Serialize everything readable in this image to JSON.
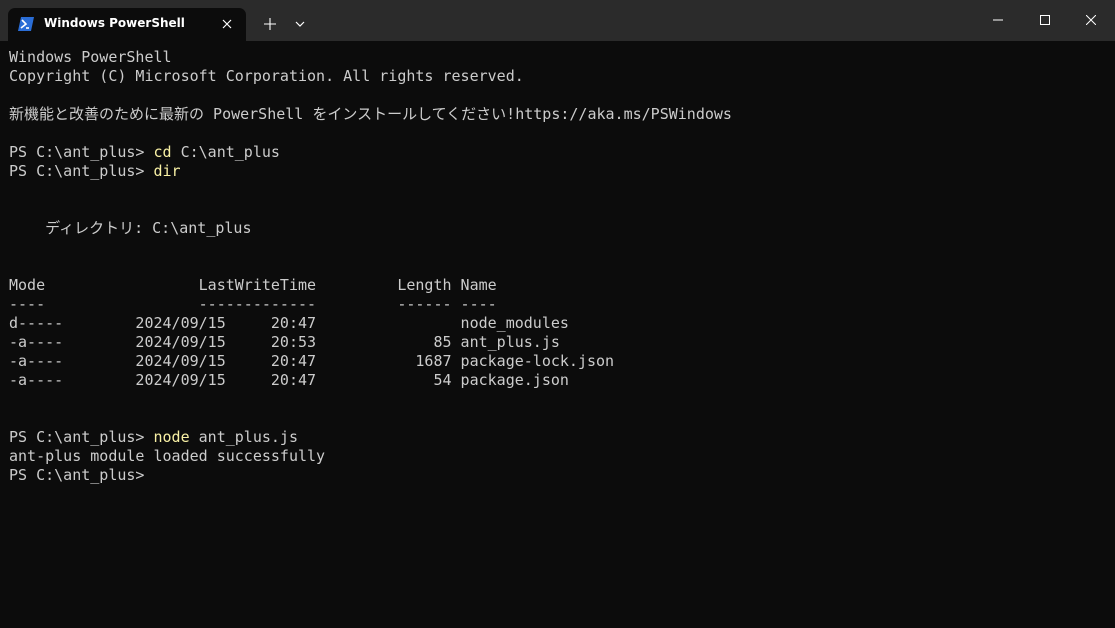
{
  "window": {
    "tab_title": "Windows PowerShell",
    "new_tab": "+"
  },
  "terminal": {
    "header_line1": "Windows PowerShell",
    "header_line2": "Copyright (C) Microsoft Corporation. All rights reserved.",
    "header_line3": "新機能と改善のために最新の PowerShell をインストールしてください!https://aka.ms/PSWindows",
    "prompt": "PS C:\\ant_plus> ",
    "cmd1_name": "cd",
    "cmd1_args": " C:\\ant_plus",
    "cmd2_name": "dir",
    "dir_label": "    ディレクトリ: C:\\ant_plus",
    "table_header": "Mode                 LastWriteTime         Length Name",
    "table_rule": "----                 -------------         ------ ----",
    "rows": [
      "d-----        2024/09/15     20:47                node_modules",
      "-a----        2024/09/15     20:53             85 ant_plus.js",
      "-a----        2024/09/15     20:47           1687 package-lock.json",
      "-a----        2024/09/15     20:47             54 package.json"
    ],
    "cmd3_name": "node",
    "cmd3_args": " ant_plus.js",
    "output": "ant-plus module loaded successfully"
  },
  "colors": {
    "background": "#0c0c0c",
    "text": "#cccccc",
    "command": "#f9f1a5",
    "titlebar": "#2b2b2b"
  },
  "icons": {
    "tab": "powershell-icon",
    "close": "close-icon",
    "dropdown": "chevron-down-icon"
  }
}
